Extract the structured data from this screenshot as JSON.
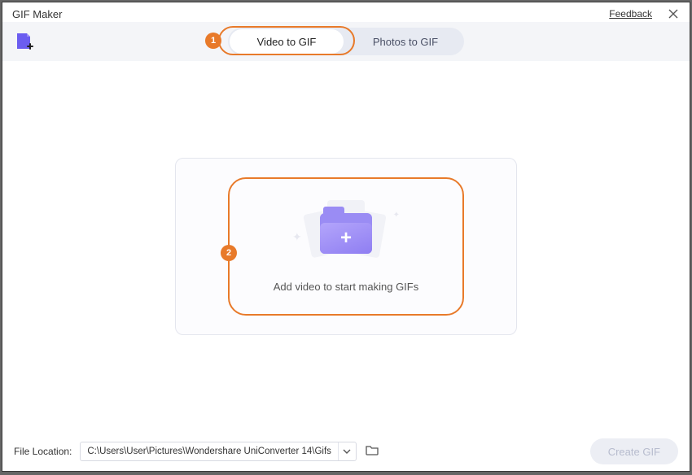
{
  "window": {
    "title": "GIF Maker",
    "feedback": "Feedback"
  },
  "tabs": {
    "video": "Video to GIF",
    "photos": "Photos to GIF"
  },
  "callouts": {
    "one": "1",
    "two": "2"
  },
  "drop": {
    "text": "Add video to start making GIFs"
  },
  "footer": {
    "label": "File Location:",
    "path": "C:\\Users\\User\\Pictures\\Wondershare UniConverter 14\\Gifs",
    "create": "Create GIF"
  }
}
